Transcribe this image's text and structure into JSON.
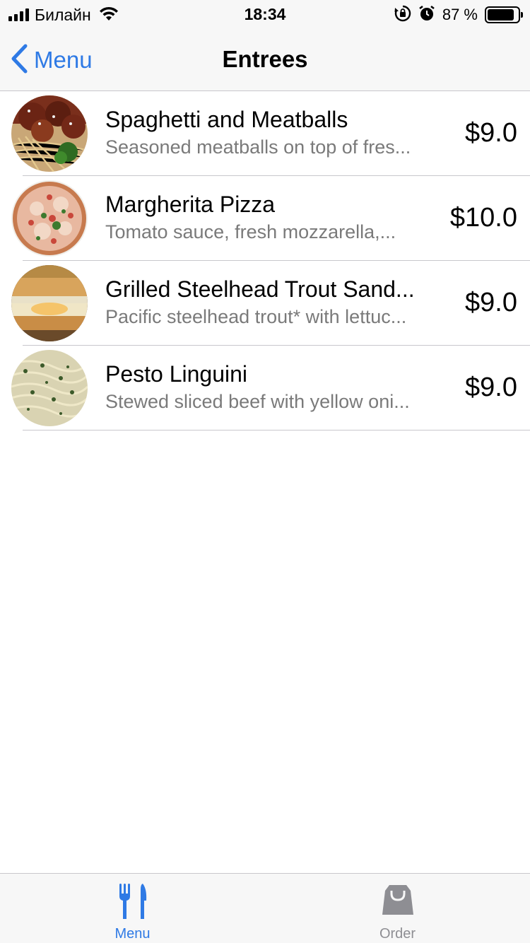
{
  "status_bar": {
    "carrier": "Билайн",
    "time": "18:34",
    "battery_percent": "87 %",
    "battery_level": 0.87,
    "icons": [
      "signal-icon",
      "wifi-icon",
      "orientation-lock-icon",
      "alarm-icon",
      "battery-icon"
    ]
  },
  "nav": {
    "back_label": "Menu",
    "title": "Entrees",
    "accent_color": "#2f7ae5"
  },
  "items": [
    {
      "name": "Spaghetti and Meatballs",
      "description": "Seasoned meatballs on top of fres...",
      "price": "$9.0",
      "image": "spaghetti-meatballs-photo"
    },
    {
      "name": "Margherita Pizza",
      "description": "Tomato sauce, fresh mozzarella,...",
      "price": "$10.0",
      "image": "margherita-pizza-photo"
    },
    {
      "name": "Grilled Steelhead Trout Sand...",
      "description": "Pacific steelhead trout* with lettuc...",
      "price": "$9.0",
      "image": "trout-sandwich-photo"
    },
    {
      "name": "Pesto Linguini",
      "description": "Stewed sliced beef with yellow oni...",
      "price": "$9.0",
      "image": "pesto-linguini-photo"
    }
  ],
  "tabs": [
    {
      "label": "Menu",
      "icon": "fork-knife-icon",
      "selected": true,
      "color": "#2f7ae5"
    },
    {
      "label": "Order",
      "icon": "shopping-bag-icon",
      "selected": false,
      "color": "#8e8e93"
    }
  ]
}
